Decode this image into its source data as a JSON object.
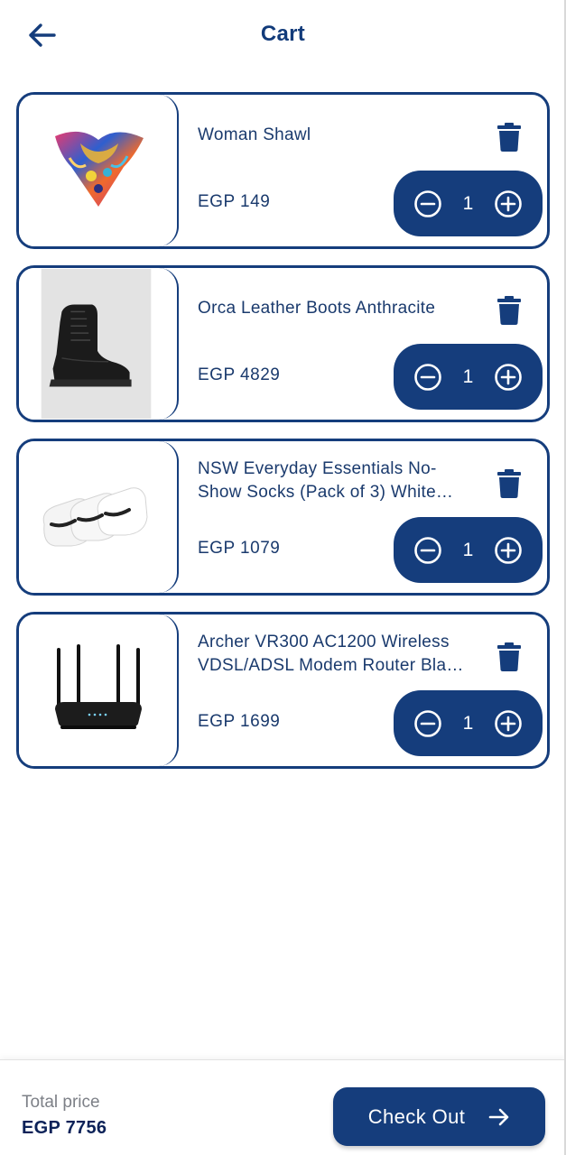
{
  "header": {
    "title": "Cart",
    "back_icon": "arrow-left-icon"
  },
  "cart": {
    "items": [
      {
        "name": "Woman Shawl",
        "price": "EGP 149",
        "quantity": "1",
        "image": "shawl"
      },
      {
        "name": "Orca Leather Boots Anthracite",
        "price": "EGP 4829",
        "quantity": "1",
        "image": "boot"
      },
      {
        "name": "NSW Everyday Essentials No-Show Socks (Pack of 3) White…",
        "price": "EGP 1079",
        "quantity": "1",
        "image": "socks"
      },
      {
        "name": "Archer VR300 AC1200 Wireless VDSL/ADSL Modem Router Bla…",
        "price": "EGP 1699",
        "quantity": "1",
        "image": "router"
      }
    ]
  },
  "footer": {
    "total_label": "Total price",
    "total_value": "EGP 7756",
    "checkout_label": "Check Out",
    "checkout_icon": "arrow-right-icon"
  },
  "colors": {
    "primary": "#153d7c",
    "text": "#1a3a6d",
    "muted": "#7d8087",
    "total": "#0c2258"
  }
}
